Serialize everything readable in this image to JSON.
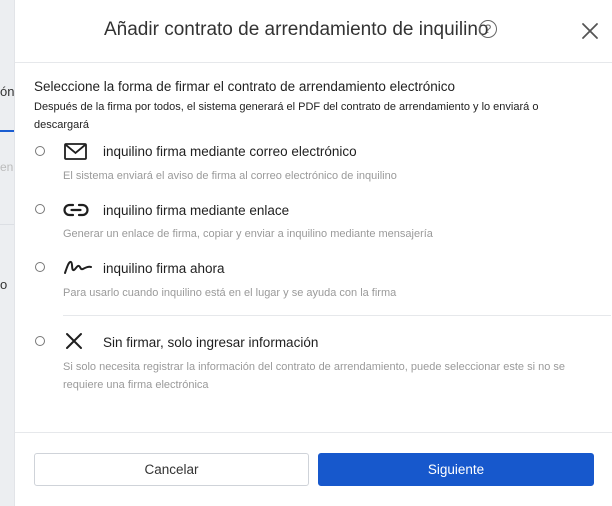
{
  "background": {
    "tab_text": "ón",
    "faint_text": "en",
    "side_text": "o"
  },
  "dialog": {
    "title": "Añadir contrato de arrendamiento de inquilino",
    "help_icon": "question-circle-icon",
    "close_icon": "close-icon",
    "help_glyph": "?"
  },
  "section": {
    "title": "Seleccione la forma de firmar el contrato de arrendamiento electrónico",
    "description": "Después de la firma por todos, el sistema generará el PDF del contrato de arrendamiento y lo enviará o descargará"
  },
  "options": [
    {
      "icon": "envelope-icon",
      "label": "inquilino firma mediante correo electrónico",
      "description": "El sistema enviará el aviso de firma al correo electrónico de inquilino"
    },
    {
      "icon": "link-icon",
      "label": "inquilino firma mediante enlace",
      "description": "Generar un enlace de firma, copiar y enviar a inquilino mediante mensajería"
    },
    {
      "icon": "signature-icon",
      "label": "inquilino firma ahora",
      "description": "Para usarlo cuando inquilino está en el lugar y se ayuda con la firma"
    },
    {
      "icon": "x-icon",
      "label": "Sin firmar, solo ingresar información",
      "description": "Si solo necesita registrar la información del contrato de arrendamiento, puede seleccionar este si no se requiere una firma electrónica"
    }
  ],
  "footer": {
    "cancel_label": "Cancelar",
    "next_label": "Siguiente"
  },
  "colors": {
    "primary": "#1758cc",
    "muted_text": "#9a9a9a"
  }
}
